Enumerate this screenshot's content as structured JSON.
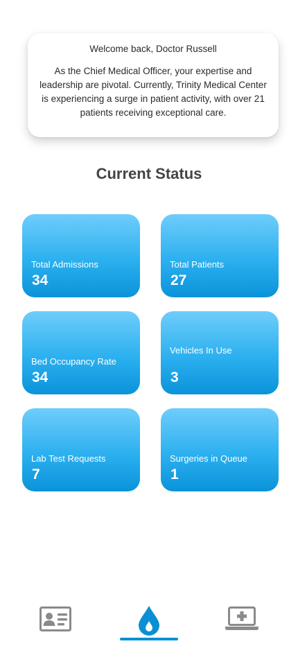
{
  "welcome": {
    "title": "Welcome back, Doctor Russell",
    "message": "As the Chief Medical Officer, your expertise and leadership are pivotal. Currently, Trinity Medical Center is experiencing a surge in patient activity, with over 21 patients receiving exceptional care."
  },
  "status": {
    "heading": "Current Status",
    "tiles": [
      {
        "label": "Total Admissions",
        "value": "34"
      },
      {
        "label": "Total Patients",
        "value": "27"
      },
      {
        "label": "Bed Occupancy Rate",
        "value": "34"
      },
      {
        "label": "Vehicles In Use",
        "value": "3"
      },
      {
        "label": "Lab Test Requests",
        "value": "7"
      },
      {
        "label": "Surgeries in Queue",
        "value": "1"
      }
    ]
  },
  "nav": {
    "items": [
      {
        "icon": "id-card-icon",
        "active": false
      },
      {
        "icon": "blood-drop-icon",
        "active": true
      },
      {
        "icon": "laptop-medical-icon",
        "active": false
      }
    ],
    "active_color": "#0a8fd4",
    "inactive_color": "#8a8a8a"
  },
  "colors": {
    "tile_gradient_top": "#6fcdfb",
    "tile_gradient_bottom": "#0a93da"
  }
}
